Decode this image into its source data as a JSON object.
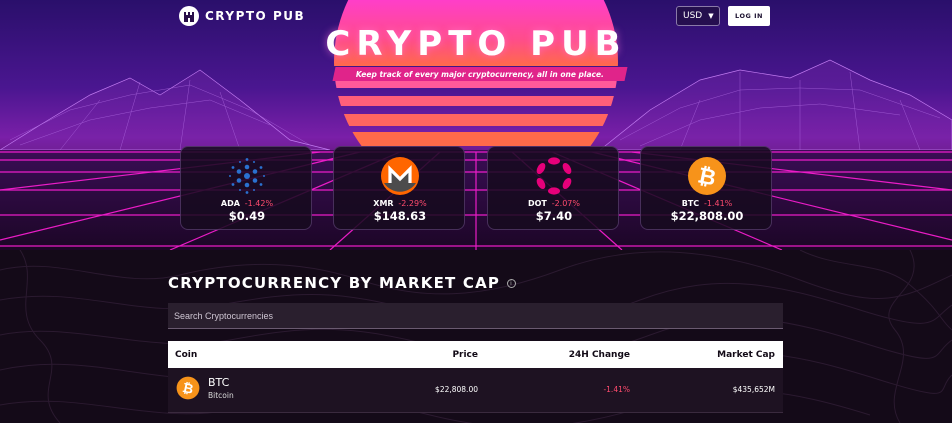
{
  "header": {
    "logo_text": "CRYPTO PUB",
    "currency": "USD",
    "login_label": "LOG IN"
  },
  "hero": {
    "title": "CRYPTO PUB",
    "subtitle": "Keep track of every major cryptocurrency, all in one place."
  },
  "cards": [
    {
      "symbol": "ADA",
      "change": "-1.42%",
      "price": "$0.49",
      "icon": "cardano-icon"
    },
    {
      "symbol": "XMR",
      "change": "-2.29%",
      "price": "$148.63",
      "icon": "monero-icon"
    },
    {
      "symbol": "DOT",
      "change": "-2.07%",
      "price": "$7.40",
      "icon": "polkadot-icon"
    },
    {
      "symbol": "BTC",
      "change": "-1.41%",
      "price": "$22,808.00",
      "icon": "bitcoin-icon"
    }
  ],
  "market": {
    "title": "CRYPTOCURRENCY BY MARKET CAP",
    "search_placeholder": "Search Cryptocurrencies",
    "columns": {
      "coin": "Coin",
      "price": "Price",
      "change": "24H Change",
      "cap": "Market Cap"
    },
    "rows": [
      {
        "symbol": "BTC",
        "name": "Bitcoin",
        "price": "$22,808.00",
        "change": "-1.41%",
        "cap": "$435,652M"
      }
    ]
  },
  "colors": {
    "accent_pink": "#e0248a",
    "negative": "#ff4b6e",
    "bitcoin": "#f7931a",
    "cardano": "#2a71d0",
    "polkadot": "#e6007a",
    "monero": "#ff6600"
  }
}
